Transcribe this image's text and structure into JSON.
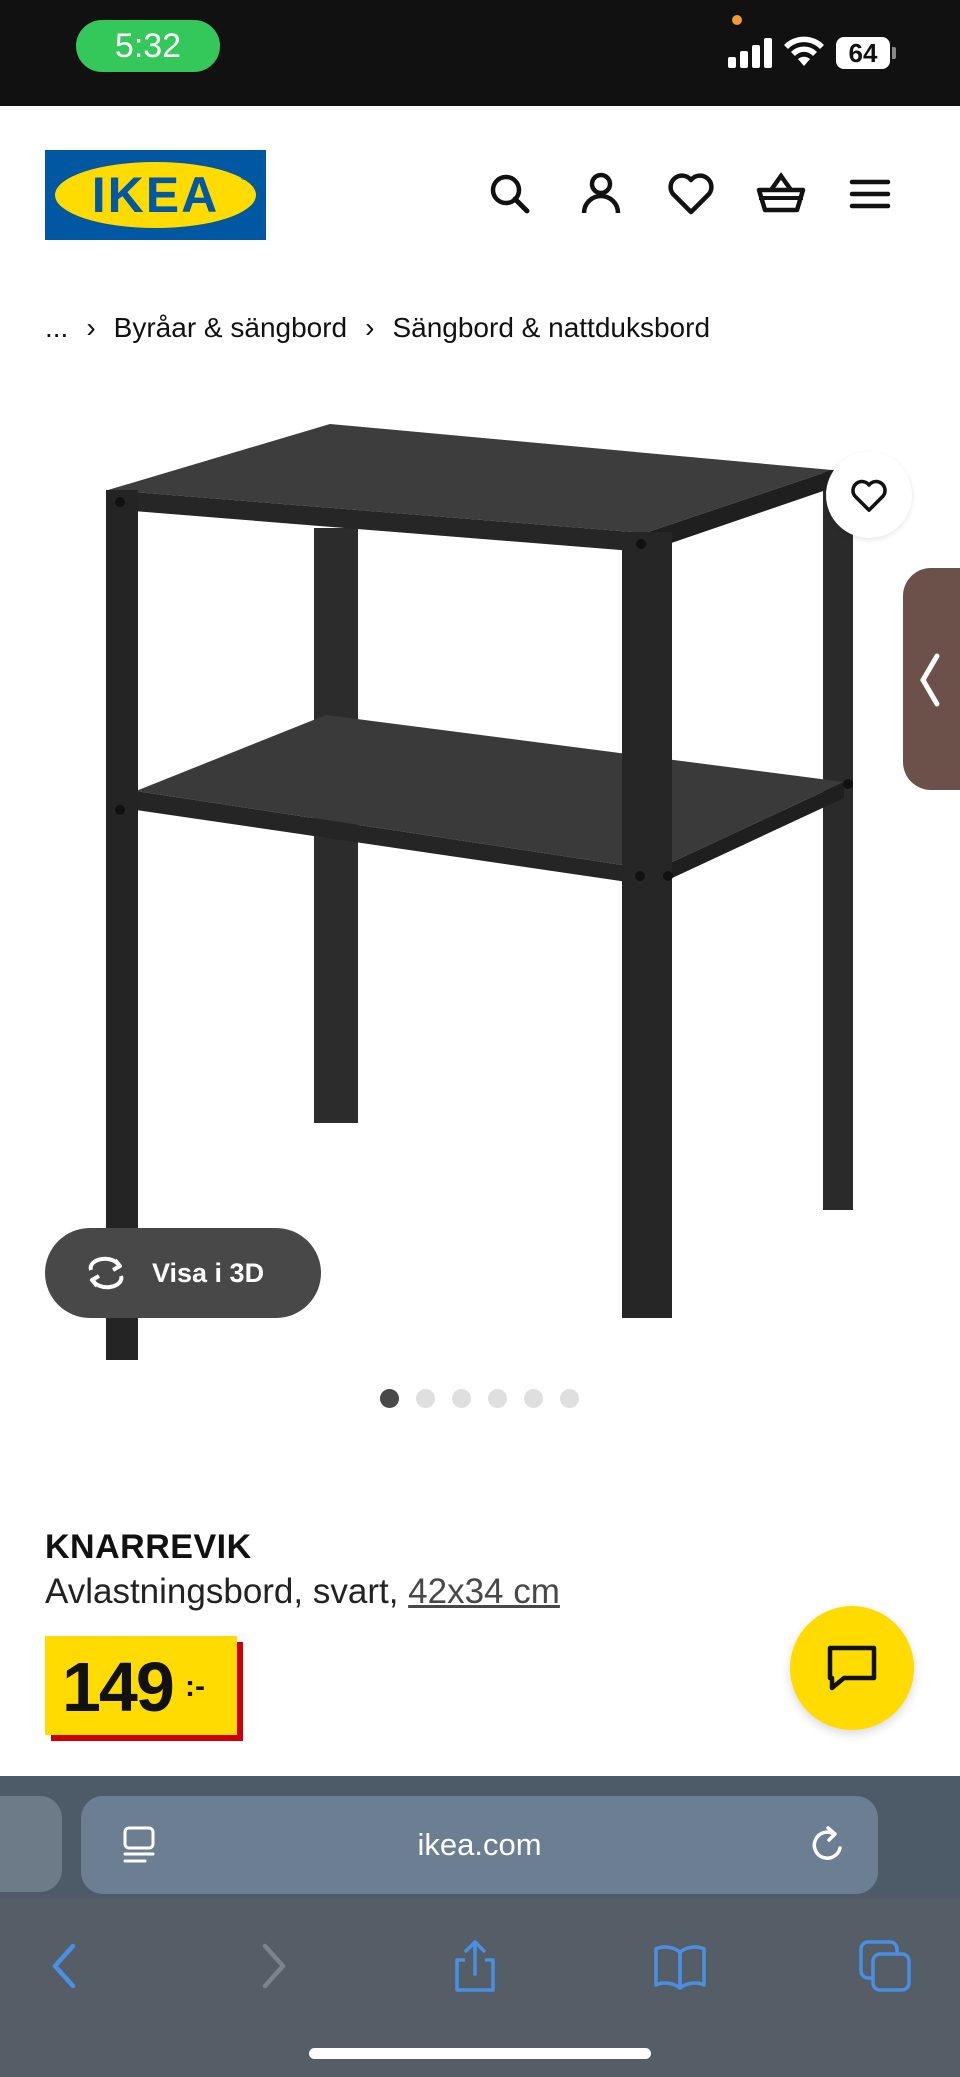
{
  "status_bar": {
    "time": "5:32",
    "battery": "64"
  },
  "header": {
    "logo_text": "IKEA",
    "icons": [
      "search-icon",
      "user-icon",
      "heart-icon",
      "basket-icon",
      "menu-icon"
    ]
  },
  "breadcrumb": {
    "ellipsis": "...",
    "items": [
      "Byråar & sängbord",
      "Sängbord & nattduksbord"
    ]
  },
  "product_image": {
    "view_3d_label": "Visa i 3D",
    "slide_count": 6,
    "active_slide": 1
  },
  "product": {
    "name": "KNARREVIK",
    "description": "Avlastningsbord, svart,",
    "size_link": "42x34 cm",
    "price": "149",
    "price_suffix": ":-"
  },
  "browser": {
    "url": "ikea.com"
  },
  "colors": {
    "ikea_blue": "#0058a3",
    "ikea_yellow": "#ffdb00",
    "price_shadow_red": "#cc0008",
    "safari_blue": "#4a90e2"
  }
}
